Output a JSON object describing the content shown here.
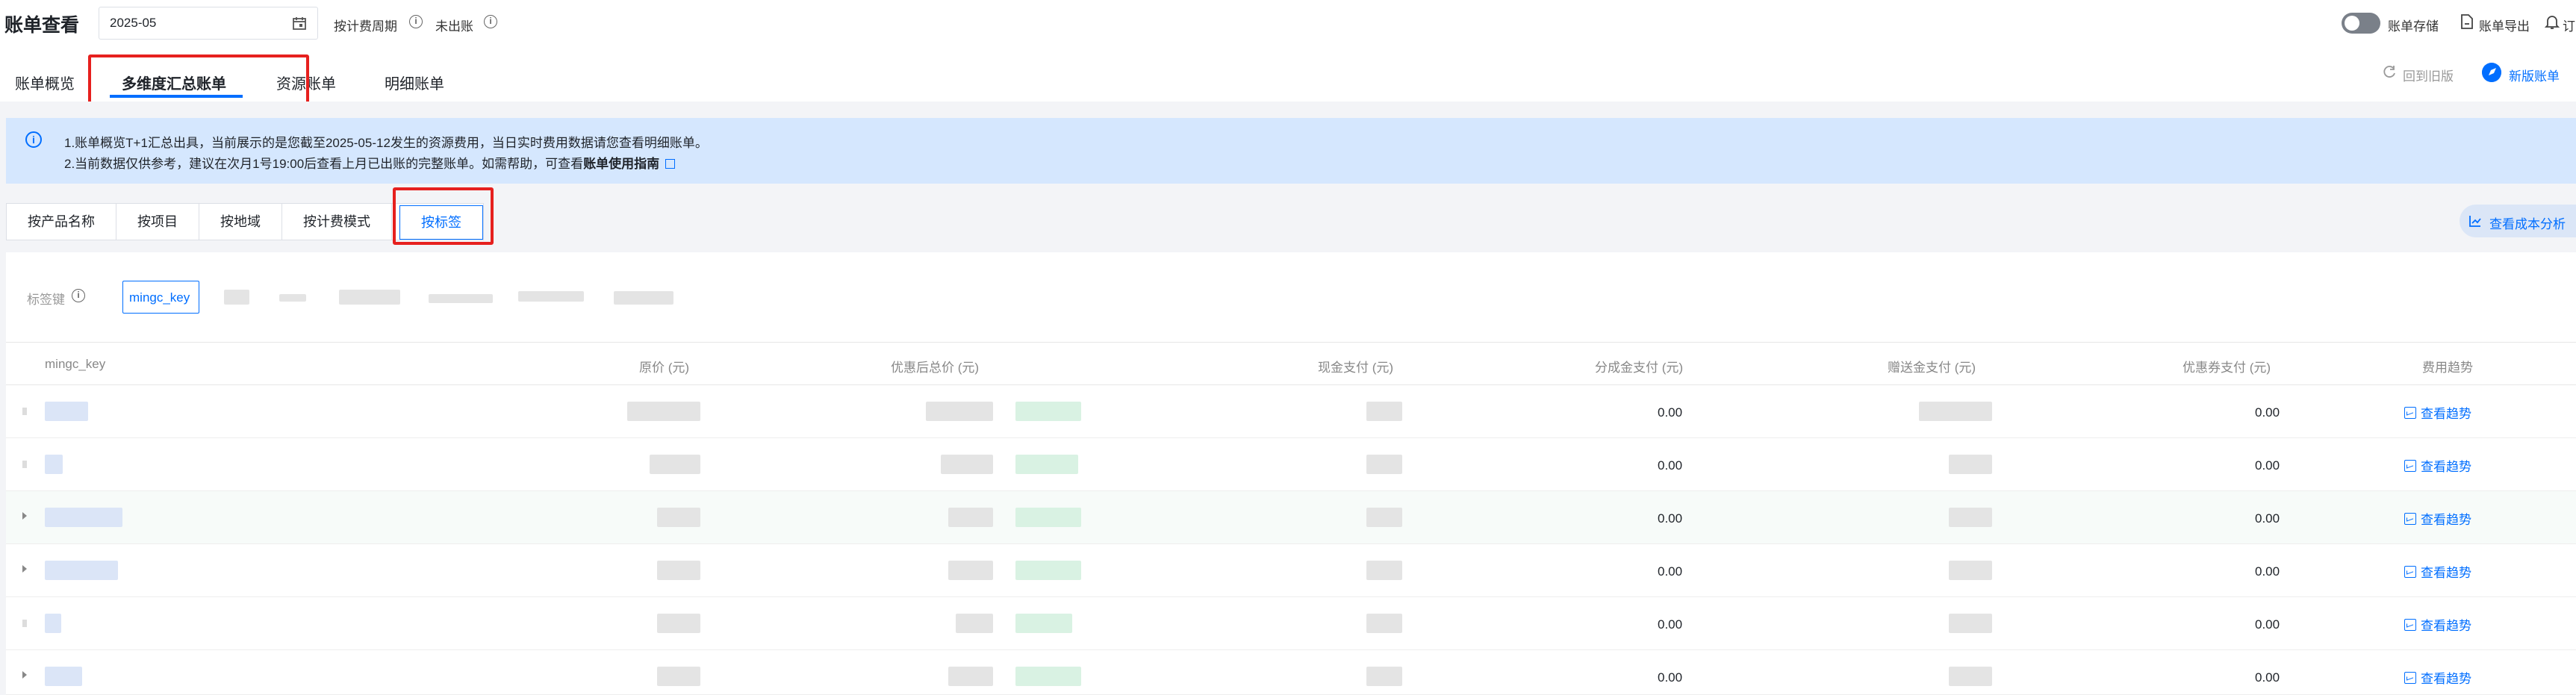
{
  "header": {
    "title": "账单查看",
    "month_value": "2025-05",
    "period_label": "按计费周期",
    "unbilled_label": "未出账",
    "storage_label": "账单存储",
    "export_label": "账单导出",
    "subscribe_label": "订"
  },
  "tabs": {
    "items": [
      "账单概览",
      "多维度汇总账单",
      "资源账单",
      "明细账单"
    ],
    "active": "多维度汇总账单",
    "revert_label": "回到旧版",
    "new_version_label": "新版账单"
  },
  "notice": {
    "line1": "1.账单概览T+1汇总出具，当前展示的是您截至2025-05-12发生的资源费用，当日实时费用数据请您查看明细账单。",
    "line2_prefix": "2.当前数据仅供参考，建议在次月1号19:00后查看上月已出账的完整账单。如需帮助，可查看",
    "line2_link": "账单使用指南"
  },
  "dimension_tabs": {
    "items": [
      "按产品名称",
      "按项目",
      "按地域",
      "按计费模式",
      "按标签"
    ],
    "active": "按标签"
  },
  "cost_analysis_label": "查看成本分析",
  "tag_filter": {
    "label": "标签键",
    "selected": "mingc_key"
  },
  "table": {
    "columns": [
      "mingc_key",
      "原价 (元)",
      "优惠后总价 (元)",
      "现金支付 (元)",
      "分成金支付 (元)",
      "赠送金支付 (元)",
      "优惠券支付 (元)",
      "费用趋势"
    ],
    "rows": [
      {
        "expandable": false,
        "share_pay": "0.00",
        "coupon_pay": "0.00",
        "trend": "查看趋势"
      },
      {
        "expandable": false,
        "share_pay": "0.00",
        "coupon_pay": "0.00",
        "trend": "查看趋势"
      },
      {
        "expandable": true,
        "share_pay": "0.00",
        "coupon_pay": "0.00",
        "trend": "查看趋势"
      },
      {
        "expandable": true,
        "share_pay": "0.00",
        "coupon_pay": "0.00",
        "trend": "查看趋势"
      },
      {
        "expandable": false,
        "share_pay": "0.00",
        "coupon_pay": "0.00",
        "trend": "查看趋势"
      },
      {
        "expandable": true,
        "share_pay": "0.00",
        "coupon_pay": "0.00",
        "trend": "查看趋势"
      }
    ]
  },
  "colors": {
    "accent": "#006eff",
    "highlight": "#e6201e",
    "notice_bg": "#d5e7fe"
  }
}
